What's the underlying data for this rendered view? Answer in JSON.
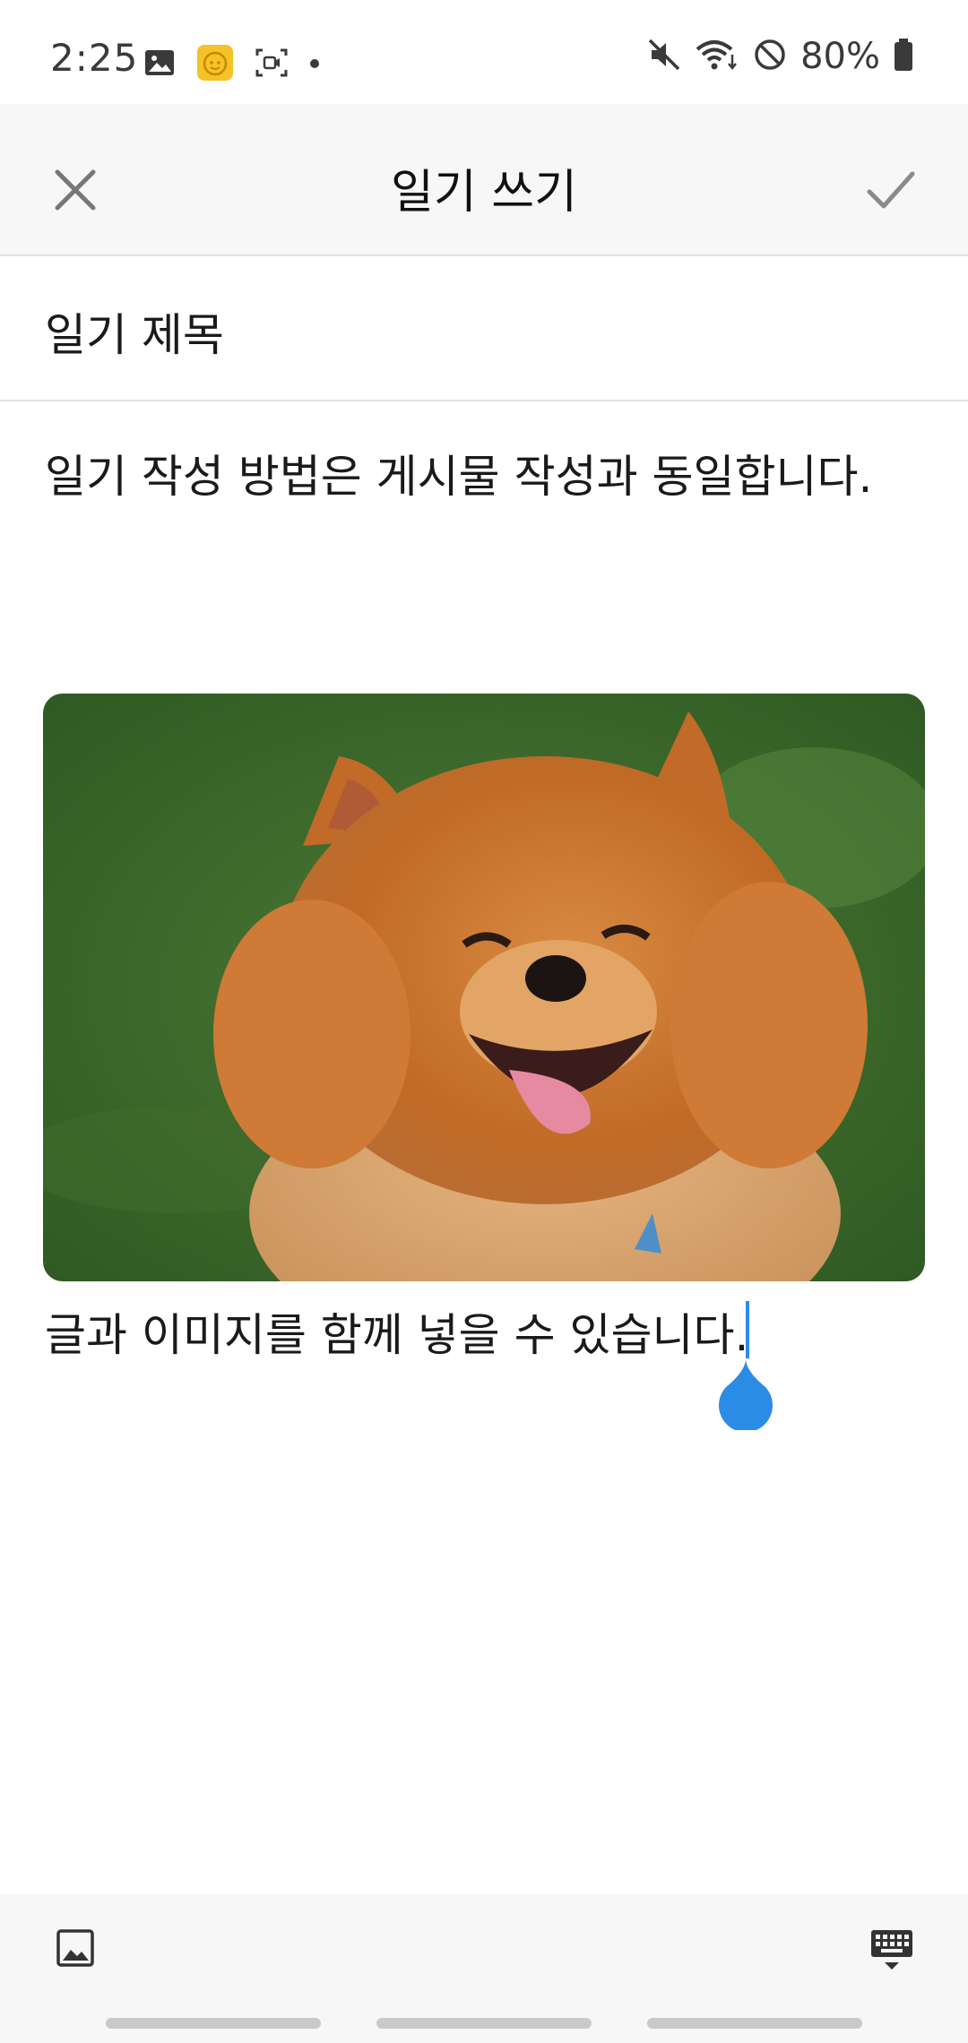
{
  "status_bar": {
    "time": "2:25",
    "battery": "80%",
    "icons_left": [
      "gallery-icon",
      "baby-face-app-icon",
      "screen-record-icon",
      "dot-icon"
    ],
    "icons_right": [
      "mute-icon",
      "wifi-icon",
      "no-disturb-icon",
      "battery-icon"
    ],
    "app_badge_color": "#f5c228"
  },
  "header": {
    "title": "일기 쓰기",
    "close_icon": "close-icon",
    "confirm_icon": "check-icon"
  },
  "editor": {
    "title_value": "일기 제목",
    "body_text": "일기 작성 방법은 게시물 작성과 동일합니다.",
    "image_subject": "smiling orange pomeranian dog on grass",
    "caption_text": "글과 이미지를 함께 넣을 수 있습니다.",
    "cursor_color": "#2b8ce6"
  },
  "toolbar": {
    "insert_image_icon": "image-icon",
    "keyboard_icon": "keyboard-hide-icon"
  },
  "colors": {
    "header_bg": "#f7f7f7",
    "divider": "#e2e2e2",
    "accent": "#2b8ce6"
  }
}
